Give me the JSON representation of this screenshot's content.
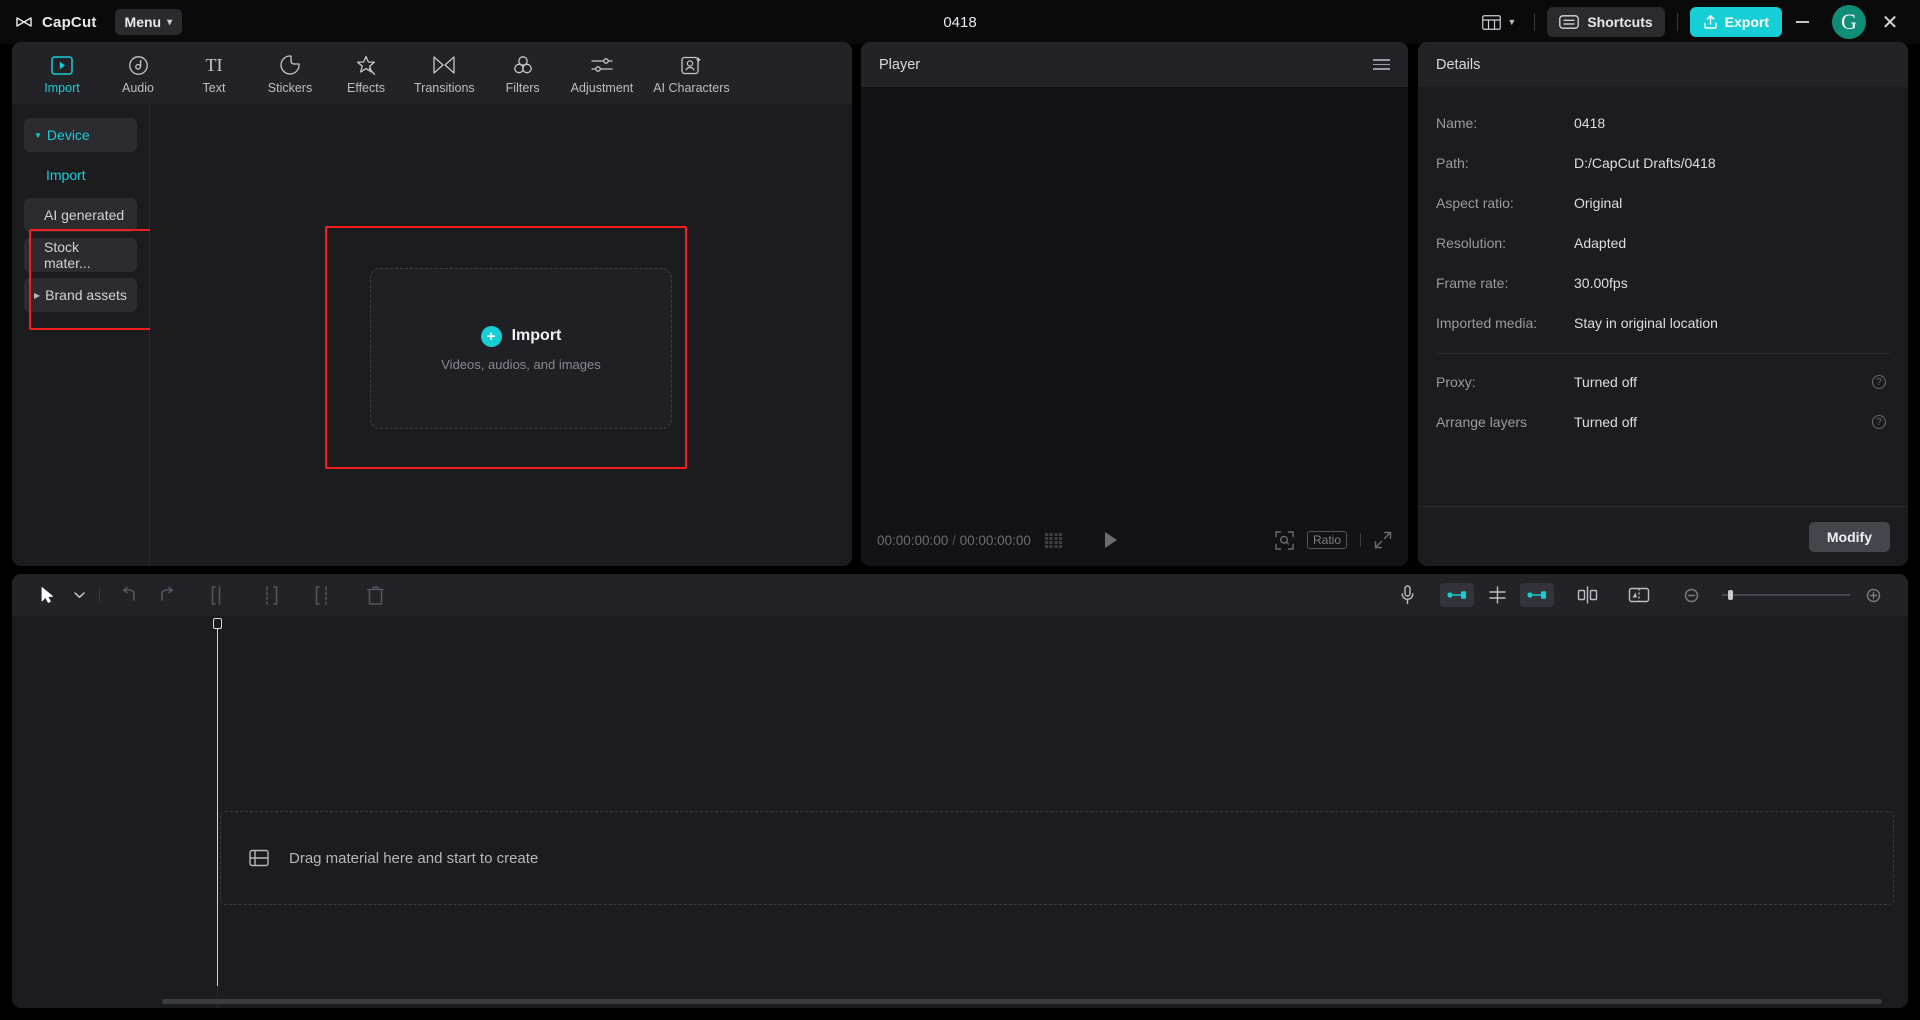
{
  "titlebar": {
    "brand": "CapCut",
    "logo_icon": "capcut-logo-icon",
    "menu_label": "Menu",
    "menu_chevron": "chevron-down-icon",
    "project_title": "0418",
    "layout_icon": "layout-grid-icon",
    "shortcuts_label": "Shortcuts",
    "shortcuts_icon": "keyboard-icon",
    "export_label": "Export",
    "export_icon": "upload-icon",
    "minimize_icon": "minimize-icon",
    "avatar_letter": "G",
    "close_icon": "close-icon"
  },
  "accent": "#16cfd6",
  "highlight_color": "#f51d1d",
  "tabs": [
    {
      "label": "Import",
      "icon": "import-play-icon",
      "active": true
    },
    {
      "label": "Audio",
      "icon": "audio-note-icon",
      "active": false
    },
    {
      "label": "Text",
      "icon": "text-ti-icon",
      "active": false
    },
    {
      "label": "Stickers",
      "icon": "sticker-icon",
      "active": false
    },
    {
      "label": "Effects",
      "icon": "effects-star-icon",
      "active": false
    },
    {
      "label": "Transitions",
      "icon": "transitions-bowtie-icon",
      "active": false
    },
    {
      "label": "Filters",
      "icon": "filters-circles-icon",
      "active": false
    },
    {
      "label": "Adjustment",
      "icon": "adjustment-sliders-icon",
      "active": false
    },
    {
      "label": "AI Characters",
      "icon": "ai-character-icon",
      "active": false
    }
  ],
  "sidebar": {
    "items": [
      {
        "label": "Device",
        "type": "group",
        "expander": "triangle-down-icon"
      },
      {
        "label": "Import",
        "type": "accent"
      },
      {
        "label": "AI generated",
        "type": "sub"
      },
      {
        "label": "Stock mater...",
        "type": "sub"
      },
      {
        "label": "Brand assets",
        "type": "sub",
        "expander": "triangle-right-icon"
      }
    ]
  },
  "dropzone": {
    "plus_icon": "plus-circle-icon",
    "title": "Import",
    "subtitle": "Videos, audios, and images"
  },
  "player": {
    "title": "Player",
    "menu_icon": "hamburger-icon",
    "current_time": "00:00:00:00",
    "time_separator": "/",
    "total_time": "00:00:00:00",
    "frames_icon": "frames-icon",
    "play_icon": "play-icon",
    "zoom_icon": "magnifier-frame-icon",
    "ratio_label": "Ratio",
    "fullscreen_icon": "fullscreen-icon"
  },
  "details": {
    "title": "Details",
    "rows": [
      {
        "key": "Name:",
        "value": "0418"
      },
      {
        "key": "Path:",
        "value": "D:/CapCut Drafts/0418"
      },
      {
        "key": "Aspect ratio:",
        "value": "Original"
      },
      {
        "key": "Resolution:",
        "value": "Adapted"
      },
      {
        "key": "Frame rate:",
        "value": "30.00fps"
      },
      {
        "key": "Imported media:",
        "value": "Stay in original location"
      }
    ],
    "rows2": [
      {
        "key": "Proxy:",
        "value": "Turned off",
        "help": "?"
      },
      {
        "key": "Arrange layers",
        "value": "Turned off",
        "help": "?"
      }
    ],
    "modify_label": "Modify"
  },
  "timeline": {
    "tools": [
      {
        "name": "select-arrow-icon"
      },
      {
        "name": "select-dropdown-chevron-icon"
      },
      {
        "name": "undo-icon"
      },
      {
        "name": "redo-icon"
      },
      {
        "name": "split-icon"
      },
      {
        "name": "trim-left-icon"
      },
      {
        "name": "trim-right-icon"
      },
      {
        "name": "delete-trash-icon"
      }
    ],
    "right_tools": [
      {
        "name": "microphone-icon"
      },
      {
        "name": "speed-ramp-icon"
      },
      {
        "name": "mix-icon"
      },
      {
        "name": "keyframe-icon"
      },
      {
        "name": "split-vertical-icon"
      },
      {
        "name": "mirror-icon"
      },
      {
        "name": "zoom-out-icon"
      }
    ],
    "placeholder_icon": "media-frame-icon",
    "placeholder_text": "Drag material here and start to create"
  }
}
